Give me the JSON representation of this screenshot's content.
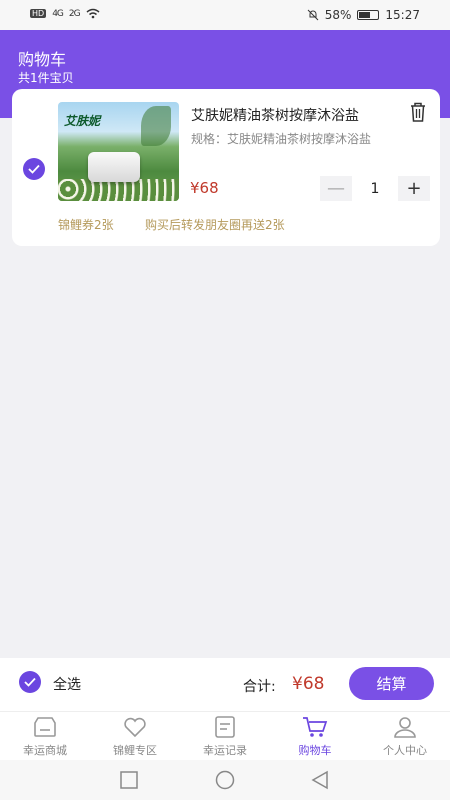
{
  "status_bar": {
    "left_badge": "HD",
    "signal1": "4G",
    "signal2": "2G",
    "battery": "58%",
    "time": "15:27"
  },
  "header": {
    "title": "购物车",
    "subtitle": "共1件宝贝"
  },
  "cart_item": {
    "name": "艾肤妮精油茶树按摩沐浴盐",
    "spec": "规格：艾肤妮精油茶树按摩沐浴盐",
    "price": "¥68",
    "quantity": "1",
    "minus_label": "—",
    "plus_label": "+",
    "thumb_logo": "艾肤妮",
    "coupons": [
      "锦鲤券2张",
      "购买后转发朋友圈再送2张"
    ]
  },
  "bottom_bar": {
    "select_all_label": "全选",
    "total_label": "合计:",
    "total_value": "¥68",
    "checkout_label": "结算"
  },
  "tabs": [
    {
      "label": "幸运商城",
      "icon": "shop-icon"
    },
    {
      "label": "锦鲤专区",
      "icon": "heart-icon"
    },
    {
      "label": "幸运记录",
      "icon": "record-icon"
    },
    {
      "label": "购物车",
      "icon": "cart-icon"
    },
    {
      "label": "个人中心",
      "icon": "user-icon"
    }
  ],
  "colors": {
    "accent": "#7a50e6",
    "price": "#c0392b",
    "coupon": "#b59a5c"
  }
}
